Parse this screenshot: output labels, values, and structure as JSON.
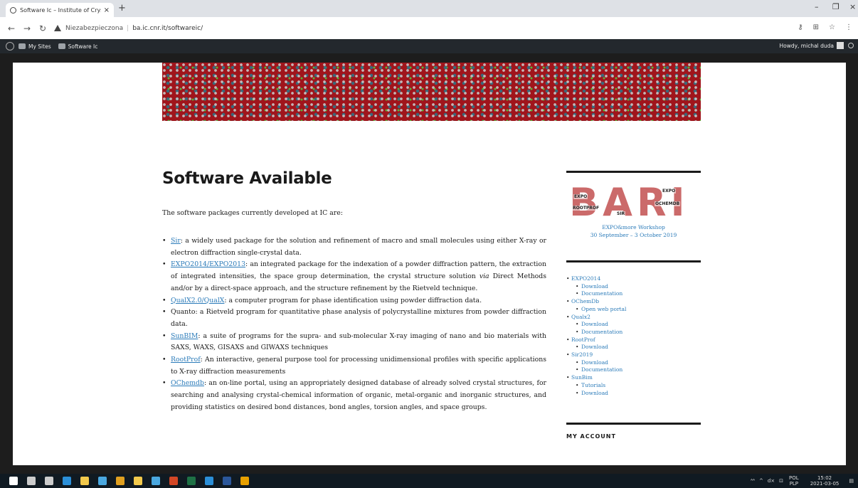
{
  "browser": {
    "tab_title": "Software Ic – Institute of Crystallo",
    "tab_close": "×",
    "new_tab": "+",
    "security_label": "Niezabezpieczona",
    "separator": "|",
    "url": "ba.ic.cnr.it/softwareic/",
    "window_controls": [
      "–",
      "❐",
      "×"
    ],
    "nav_icons": [
      "arrow-back-icon",
      "arrow-forward-icon",
      "reload-icon"
    ],
    "toolbar_icons": [
      "key-icon",
      "translate-icon",
      "star-icon",
      "menu-icon"
    ]
  },
  "adminbar": {
    "my_sites": "My Sites",
    "site_name": "Software Ic",
    "howdy": "Howdy, michal duda"
  },
  "main": {
    "title": "Software Available",
    "intro": "The software packages currently developed at IC are:",
    "items": [
      {
        "link": "Sir",
        "text": ": a widely used package for the solution and refinement of macro and small  molecules using either X-ray or electron diffraction single-crystal data."
      },
      {
        "link": "EXPO2014/EXPO2013",
        "text": ": an integrated package for the indexation of a powder diffraction pattern, the extraction of integrated intensities, the space group determination, the crystal structure solution ",
        "em": "via",
        "text2": " Direct Methods and/or by a direct-space approach, and the structure refinement by the Rietveld technique."
      },
      {
        "link": "QualX2.0/QualX",
        "text": ": a computer program for phase identification using powder diffraction data."
      },
      {
        "plain": "Quanto: a Rietveld program for quantitative phase analysis of polycrystalline mixtures from powder diffraction data."
      },
      {
        "link": "SunBIM",
        "text": ": a suite of programs for the supra- and sub-molecular X-ray imaging of nano and bio materials with SAXS, WAXS, GISAXS and GIWAXS techniques"
      },
      {
        "link": "RootProf",
        "text": ": An interactive, general purpose tool for processing unidimensional profiles with specific applications to X-ray diffraction measurements"
      },
      {
        "link": "OChemdb",
        "text": ": an on-line portal, using an appropriately designed database of already solved crystal structures, for searching and analysing crystal-chemical information of organic, metal-organic and inorganic structures, and providing statistics on desired bond distances, bond angles, torsion angles, and space groups."
      }
    ]
  },
  "sidebar": {
    "bari_logo": "BARI",
    "bari_tags": [
      "EXPO",
      "ROOTPROF",
      "OCHEMDB",
      "EXPO",
      "SIR"
    ],
    "workshop_title": "EXPO&more Workshop",
    "workshop_dates": "30 September – 3 October 2019",
    "menu": [
      {
        "label": "EXPO2014",
        "children": [
          "Download",
          "Documentation"
        ]
      },
      {
        "label": "OChemDb",
        "children": [
          "Open web portal"
        ]
      },
      {
        "label": "Qualx2",
        "children": [
          "Download",
          "Documentation"
        ]
      },
      {
        "label": "RootProf",
        "children": [
          "Download"
        ]
      },
      {
        "label": "Sir2019",
        "children": [
          "Download",
          "Documentation"
        ]
      },
      {
        "label": "SunBim",
        "children": [
          "Tutorials",
          "Download"
        ]
      }
    ],
    "next_widget_title": "MY ACCOUNT"
  },
  "taskbar": {
    "icons": [
      "windows-start-icon",
      "search-icon",
      "task-view-icon",
      "edge-icon",
      "file-explorer-icon",
      "store-icon",
      "chrome-icon",
      "folder-icon",
      "mail-icon",
      "powerpoint-icon",
      "excel-icon",
      "app-icon",
      "word-icon",
      "chrome-active-icon"
    ],
    "icon_colors": [
      "#ffffff",
      "#cccccc",
      "#cccccc",
      "#2b8fd8",
      "#f2c94c",
      "#4aa8e0",
      "#e0a020",
      "#f2c94c",
      "#4aa8e0",
      "#d24726",
      "#1e7145",
      "#2b8fd8",
      "#2b579a",
      "#e8a000"
    ],
    "tray": [
      "ᴬᴬ",
      "^",
      "d×",
      "⊡"
    ],
    "lang_top": "POL",
    "lang_bottom": "PLP",
    "time": "15:02",
    "date": "2021-03-05"
  }
}
